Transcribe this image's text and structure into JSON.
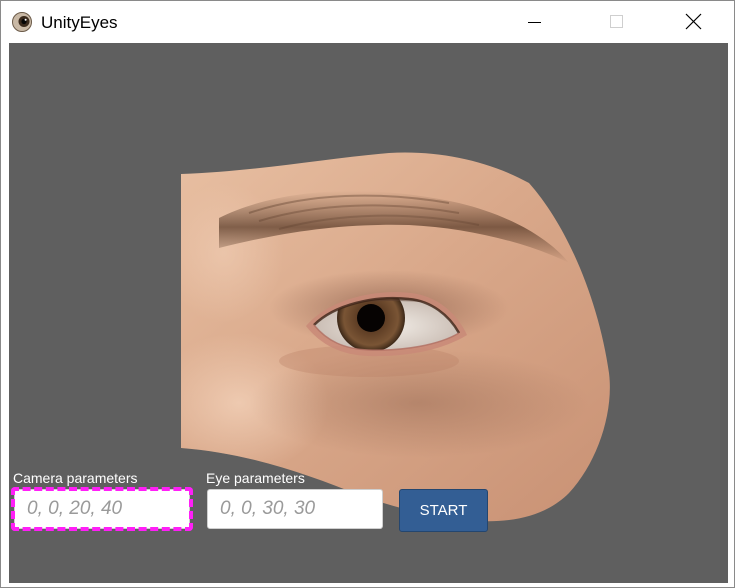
{
  "window": {
    "title": "UnityEyes",
    "app_icon": "eyeball-icon",
    "controls": {
      "minimize_icon": "minimize-icon",
      "maximize_icon": "maximize-icon",
      "close_icon": "close-icon"
    }
  },
  "viewport": {
    "background_color": "#5f5f5f",
    "content": "rendered-eye-region"
  },
  "form": {
    "camera_label": "Camera parameters",
    "camera_placeholder": "0, 0, 20, 40",
    "camera_value": "",
    "eye_label": "Eye parameters",
    "eye_placeholder": "0, 0, 30, 30",
    "eye_value": "",
    "start_label": "START",
    "start_color": "#335e94",
    "focus_ring_color": "#ff1ff7"
  }
}
